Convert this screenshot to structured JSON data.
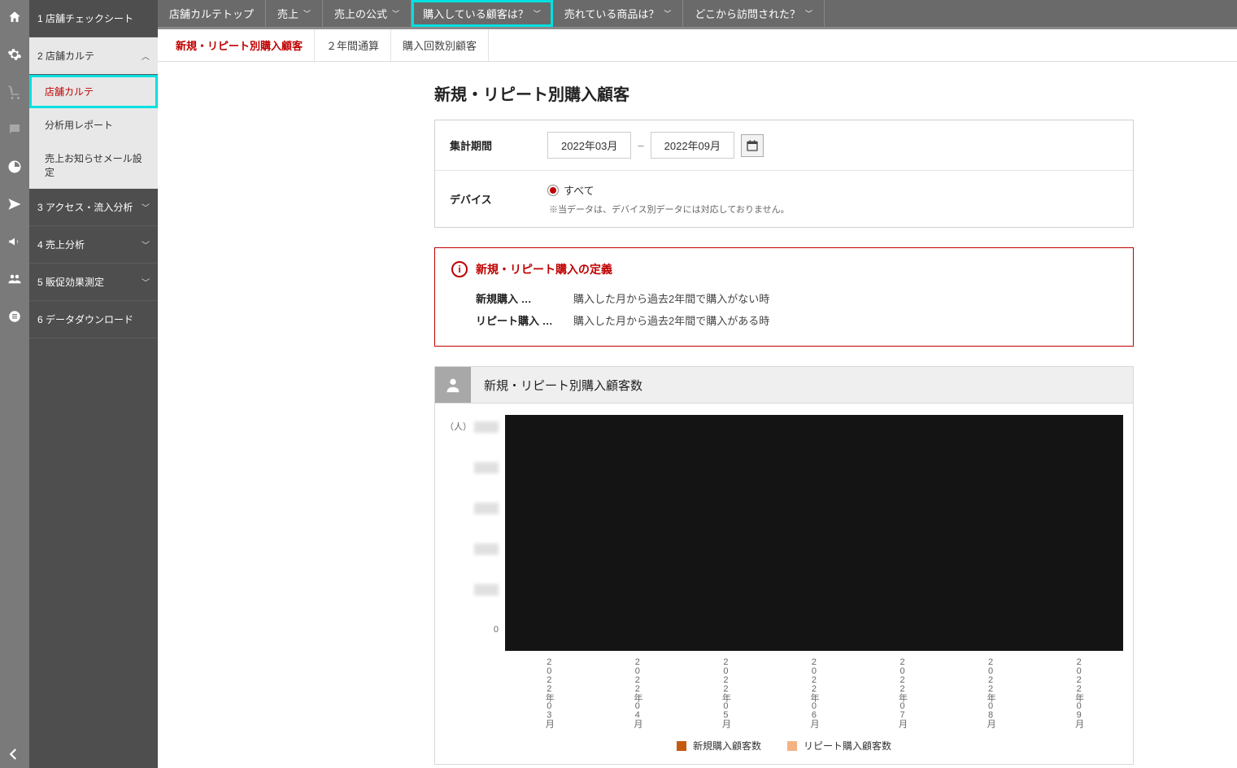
{
  "sidebar": {
    "items": [
      {
        "label": "1 店舗チェックシート"
      },
      {
        "label": "2 店舗カルテ"
      },
      {
        "label": "3 アクセス・流入分析"
      },
      {
        "label": "4 売上分析"
      },
      {
        "label": "5 販促効果測定"
      },
      {
        "label": "6 データダウンロード"
      }
    ],
    "sub": [
      {
        "label": "店舗カルテ"
      },
      {
        "label": "分析用レポート"
      },
      {
        "label": "売上お知らせメール設定"
      }
    ]
  },
  "topnav": [
    {
      "label": "店舗カルテトップ",
      "chev": false
    },
    {
      "label": "売上",
      "chev": true
    },
    {
      "label": "売上の公式",
      "chev": true
    },
    {
      "label": "購入している顧客は？",
      "chev": true,
      "highlight": true
    },
    {
      "label": "売れている商品は？",
      "chev": true
    },
    {
      "label": "どこから訪問された？",
      "chev": true
    }
  ],
  "subtabs": [
    {
      "label": "新規・リピート別購入顧客",
      "active": true
    },
    {
      "label": "２年間通算",
      "active": false
    },
    {
      "label": "購入回数別顧客",
      "active": false
    }
  ],
  "page": {
    "title": "新規・リピート別購入顧客"
  },
  "filters": {
    "period_label": "集計期間",
    "date_from": "2022年03月",
    "date_dash": "–",
    "date_to": "2022年09月",
    "device_label": "デバイス",
    "device_value": "すべて",
    "device_note": "※当データは、デバイス別データには対応しておりません。"
  },
  "info": {
    "title": "新規・リピート購入の定義",
    "rows": [
      {
        "k": "新規購入 …",
        "v": "購入した月から過去2年間で購入がない時"
      },
      {
        "k": "リピート購入 …",
        "v": "購入した月から過去2年間で購入がある時"
      }
    ]
  },
  "chart": {
    "title": "新規・リピート別購入顧客数",
    "yunit": "（人）",
    "zero": "0",
    "legend": [
      {
        "label": "新規購入顧客数",
        "cls": "a"
      },
      {
        "label": "リピート購入顧客数",
        "cls": "b"
      }
    ]
  },
  "chart_data": {
    "type": "bar",
    "title": "新規・リピート別購入顧客数",
    "xlabel": "",
    "ylabel": "（人）",
    "categories": [
      "2022年03月",
      "2022年04月",
      "2022年05月",
      "2022年06月",
      "2022年07月",
      "2022年08月",
      "2022年09月"
    ],
    "series": [
      {
        "name": "新規購入顧客数",
        "values": [
          null,
          null,
          null,
          null,
          null,
          null,
          null
        ]
      },
      {
        "name": "リピート購入顧客数",
        "values": [
          null,
          null,
          null,
          null,
          null,
          null,
          null
        ]
      }
    ],
    "note": "Chart values and y-axis tick labels are obscured/redacted in the screenshot."
  }
}
